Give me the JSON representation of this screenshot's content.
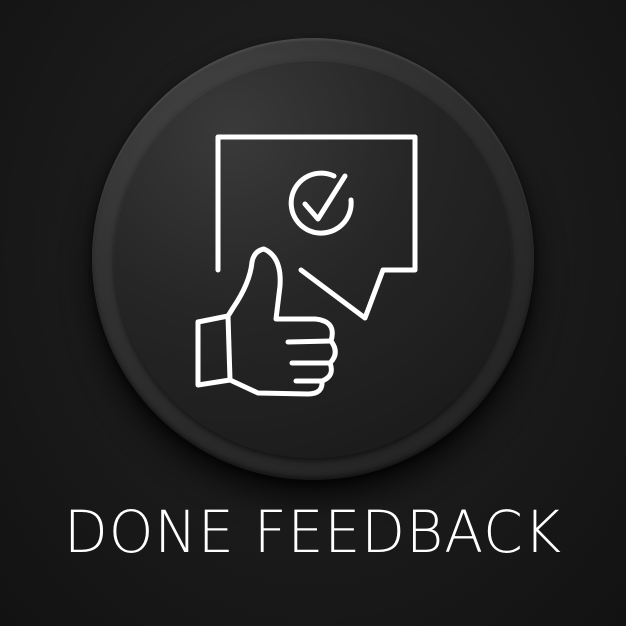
{
  "label": "DONE FEEDBACK",
  "icon": {
    "name": "done-feedback-icon",
    "parts": [
      "speech-bubble-icon",
      "check-circle-icon",
      "thumbs-up-icon"
    ]
  },
  "colors": {
    "background": "#1a1a1a",
    "button": "#262626",
    "icon_stroke": "#ffffff",
    "text": "#ffffff"
  }
}
